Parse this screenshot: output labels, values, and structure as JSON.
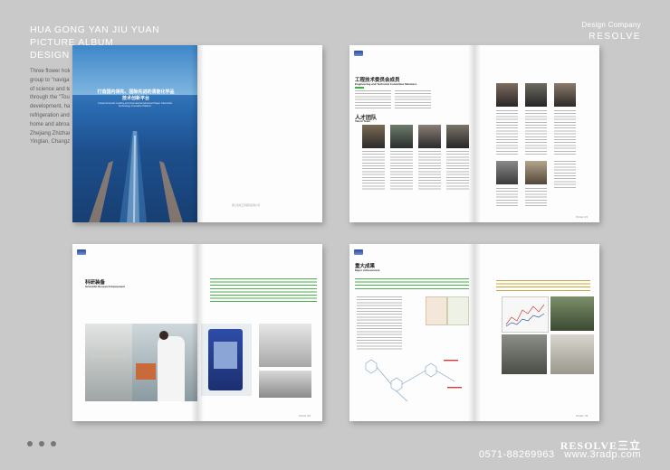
{
  "header": {
    "title_lines": [
      "HUA GONG YAN JIU YUAN",
      "PICTURE ALBUM",
      "DESIGN"
    ],
    "intro_lines": [
      "Three flower holding",
      "group to \"navigate",
      "of science and techn",
      "through the \"Touch",
      "development, has to",
      "refrigeration and ai",
      "home and abroad \"",
      "Zhejiang Zhizhang",
      "Yingtan, Changzhou"
    ]
  },
  "brand": {
    "company_label": "Design Company",
    "name": "RESOLVE"
  },
  "spreads": {
    "cover": {
      "title_cn": "打造国内领先、国际先进的清能化学品",
      "title_cn_2": "技术创新平台",
      "title_en": "Create Domestic Leading and International Advanced Paper Chemicals Technology Innovation Platform",
      "footer": "浙江省化工研究院有限公司"
    },
    "committee": {
      "title_cn": "工程技术委员会成员",
      "title_en": "Engineering and Technical Committee Members",
      "team_cn": "人才团队",
      "team_en": "Talent Team",
      "folio": "PAGE 3/4"
    },
    "equipment": {
      "title_cn": "科研装备",
      "title_en": "Scientific Research Equipment",
      "folio": "PAGE 5/6"
    },
    "achievements": {
      "title_cn": "重大成果",
      "title_en": "Major Achievement",
      "folio": "PAGE 7/8"
    }
  },
  "contact": {
    "logo_text": "RESOLVE三立",
    "phone": "0571-88269963",
    "website": "www.3radp.com"
  },
  "colors": {
    "background": "#c9c9c9",
    "accent_green": "#3fae49",
    "ocean": "#1f4f8c"
  },
  "pager": {
    "count": 3
  }
}
